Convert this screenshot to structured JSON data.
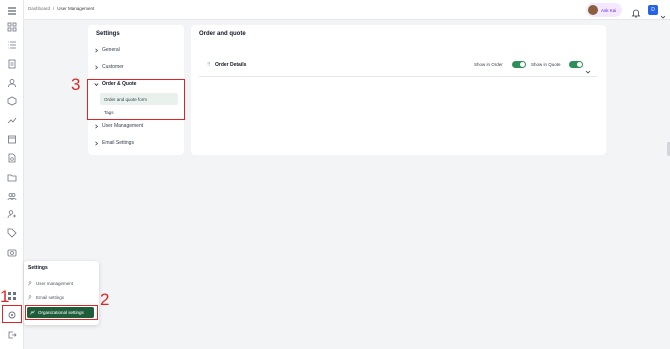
{
  "breadcrumb": {
    "home": "Dashboard",
    "sep": "/",
    "current": "User Management"
  },
  "header": {
    "ask_label": "Ask Kai",
    "user_initial": "D"
  },
  "settings_panel": {
    "title": "Settings",
    "items": [
      {
        "label": "General"
      },
      {
        "label": "Customer"
      },
      {
        "label": "Order & Quote"
      },
      {
        "label": "User Management"
      },
      {
        "label": "Email Settings"
      }
    ],
    "subitems": [
      {
        "label": "Order and quote form"
      },
      {
        "label": "Tags"
      }
    ]
  },
  "main": {
    "title": "Order and quote",
    "row_label": "Order Details",
    "drag_glyph": "⠿",
    "show_in_order_label": "Show in Order",
    "show_in_quote_label": "Show in Quote",
    "show_in_order": true,
    "show_in_quote": true
  },
  "popup": {
    "title": "Settings",
    "items": [
      {
        "label": "User management"
      },
      {
        "label": "Email settings"
      },
      {
        "label": "Organizational settings"
      }
    ]
  },
  "annotations": {
    "m1": "1",
    "m2": "2",
    "m3": "3"
  },
  "colors": {
    "accent": "#1f5c3a",
    "toggle": "#2f8f5b",
    "annotation": "#dc2626"
  }
}
